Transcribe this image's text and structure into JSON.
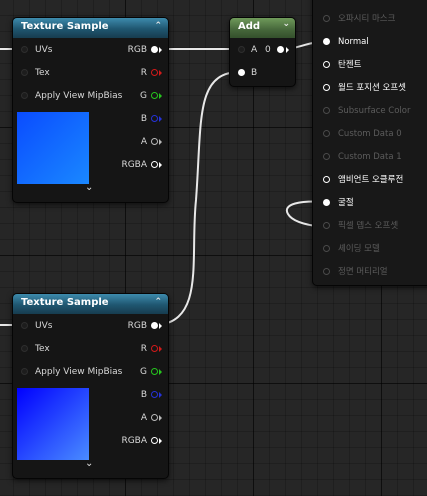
{
  "nodes": {
    "texture_sample_1": {
      "title": "Texture Sample",
      "collapse_glyph": "⌃",
      "expand_glyph": "⌄",
      "inputs": [
        "UVs",
        "Tex",
        "Apply View MipBias"
      ],
      "outputs": [
        {
          "label": "RGB",
          "color": "#ffffff",
          "style": "filled"
        },
        {
          "label": "R",
          "color": "#d21a1a",
          "style": "ring"
        },
        {
          "label": "G",
          "color": "#26c61e",
          "style": "ring"
        },
        {
          "label": "B",
          "color": "#2532d8",
          "style": "ring"
        },
        {
          "label": "A",
          "color": "#b9b9b9",
          "style": "ring"
        },
        {
          "label": "RGBA",
          "color": "#ffffff",
          "style": "ring"
        }
      ],
      "preview_colors": [
        "#0a4cff",
        "#1a88ff"
      ]
    },
    "texture_sample_2": {
      "title": "Texture Sample",
      "collapse_glyph": "⌃",
      "expand_glyph": "⌄",
      "inputs": [
        "UVs",
        "Tex",
        "Apply View MipBias"
      ],
      "outputs": [
        {
          "label": "RGB",
          "color": "#ffffff",
          "style": "filled"
        },
        {
          "label": "R",
          "color": "#d21a1a",
          "style": "ring"
        },
        {
          "label": "G",
          "color": "#26c61e",
          "style": "ring"
        },
        {
          "label": "B",
          "color": "#2532d8",
          "style": "ring"
        },
        {
          "label": "A",
          "color": "#b9b9b9",
          "style": "ring"
        },
        {
          "label": "RGBA",
          "color": "#ffffff",
          "style": "ring"
        }
      ],
      "preview_colors": [
        "#0000ff",
        "#4a8cff"
      ]
    },
    "add": {
      "title": "Add",
      "dropdown_glyph": "⌄",
      "inputs": [
        "A",
        "B"
      ],
      "output_label": "0"
    }
  },
  "material_node": {
    "pins": [
      {
        "label": "오파시티 마스크",
        "enabled": false
      },
      {
        "label": "Normal",
        "enabled": true,
        "connected": true
      },
      {
        "label": "탄젠트",
        "enabled": true
      },
      {
        "label": "월드 포지션 오프셋",
        "enabled": true
      },
      {
        "label": "Subsurface Color",
        "enabled": false
      },
      {
        "label": "Custom Data 0",
        "enabled": false
      },
      {
        "label": "Custom Data 1",
        "enabled": false
      },
      {
        "label": "앰비언트 오클루전",
        "enabled": true
      },
      {
        "label": "굴절",
        "enabled": true,
        "connected": true
      },
      {
        "label": "픽셀 뎁스 오프셋",
        "enabled": false
      },
      {
        "label": "셰이딩 모델",
        "enabled": false
      },
      {
        "label": "정면 머티리얼",
        "enabled": false
      }
    ]
  }
}
